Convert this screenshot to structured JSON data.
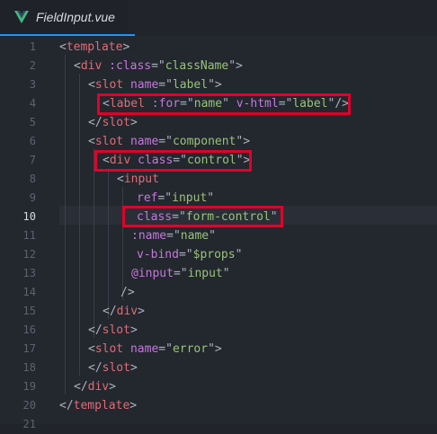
{
  "tab": {
    "title": "FieldInput.vue",
    "icon": "vue-icon"
  },
  "editor": {
    "active_line": 10,
    "line_numbers": [
      "1",
      "2",
      "3",
      "4",
      "5",
      "6",
      "7",
      "8",
      "9",
      "10",
      "11",
      "12",
      "13",
      "14",
      "15",
      "16",
      "17",
      "18",
      "19",
      "20",
      "21"
    ],
    "lines": [
      {
        "n": 1,
        "tokens": [
          [
            "punc",
            "<"
          ],
          [
            "tag",
            "template"
          ],
          [
            "punc",
            ">"
          ]
        ]
      },
      {
        "n": 2,
        "tokens": [
          [
            "punc",
            "<"
          ],
          [
            "tag",
            "div "
          ],
          [
            "attr",
            ":class"
          ],
          [
            "punc",
            "=\""
          ],
          [
            "str",
            "className"
          ],
          [
            "punc",
            "\">"
          ]
        ]
      },
      {
        "n": 3,
        "tokens": [
          [
            "punc",
            "<"
          ],
          [
            "tag",
            "slot "
          ],
          [
            "attr",
            "name"
          ],
          [
            "punc",
            "=\""
          ],
          [
            "str",
            "label"
          ],
          [
            "punc",
            "\">"
          ]
        ]
      },
      {
        "n": 4,
        "tokens": [
          [
            "punc",
            "<"
          ],
          [
            "tag",
            "label "
          ],
          [
            "attr",
            ":for"
          ],
          [
            "punc",
            "=\""
          ],
          [
            "str",
            "name"
          ],
          [
            "punc",
            "\" "
          ],
          [
            "attr",
            "v-html"
          ],
          [
            "punc",
            "=\""
          ],
          [
            "str",
            "label"
          ],
          [
            "punc",
            "\"/>"
          ]
        ]
      },
      {
        "n": 5,
        "tokens": [
          [
            "punc",
            "</"
          ],
          [
            "tag",
            "slot"
          ],
          [
            "punc",
            ">"
          ]
        ]
      },
      {
        "n": 6,
        "tokens": [
          [
            "punc",
            "<"
          ],
          [
            "tag",
            "slot "
          ],
          [
            "attr",
            "name"
          ],
          [
            "punc",
            "=\""
          ],
          [
            "str",
            "component"
          ],
          [
            "punc",
            "\">"
          ]
        ]
      },
      {
        "n": 7,
        "tokens": [
          [
            "punc",
            "<"
          ],
          [
            "tag",
            "div "
          ],
          [
            "attr",
            "class"
          ],
          [
            "punc",
            "=\""
          ],
          [
            "str",
            "control"
          ],
          [
            "punc",
            "\">"
          ]
        ]
      },
      {
        "n": 8,
        "tokens": [
          [
            "punc",
            "<"
          ],
          [
            "tag",
            "input"
          ]
        ]
      },
      {
        "n": 9,
        "tokens": [
          [
            "attr",
            "ref"
          ],
          [
            "punc",
            "=\""
          ],
          [
            "str",
            "input"
          ],
          [
            "punc",
            "\""
          ]
        ]
      },
      {
        "n": 10,
        "tokens": [
          [
            "attr",
            "class"
          ],
          [
            "punc",
            "=\""
          ],
          [
            "str",
            "form-control"
          ],
          [
            "punc",
            "\""
          ]
        ]
      },
      {
        "n": 11,
        "tokens": [
          [
            "attr",
            ":name"
          ],
          [
            "punc",
            "=\""
          ],
          [
            "str",
            "name"
          ],
          [
            "punc",
            "\""
          ]
        ]
      },
      {
        "n": 12,
        "tokens": [
          [
            "attr",
            "v-bind"
          ],
          [
            "punc",
            "=\""
          ],
          [
            "str",
            "$props"
          ],
          [
            "punc",
            "\""
          ]
        ]
      },
      {
        "n": 13,
        "tokens": [
          [
            "attr",
            "@input"
          ],
          [
            "punc",
            "=\""
          ],
          [
            "str",
            "input"
          ],
          [
            "punc",
            "\""
          ]
        ]
      },
      {
        "n": 14,
        "tokens": [
          [
            "punc",
            "/>"
          ]
        ]
      },
      {
        "n": 15,
        "tokens": [
          [
            "punc",
            "</"
          ],
          [
            "tag",
            "div"
          ],
          [
            "punc",
            ">"
          ]
        ]
      },
      {
        "n": 16,
        "tokens": [
          [
            "punc",
            "</"
          ],
          [
            "tag",
            "slot"
          ],
          [
            "punc",
            ">"
          ]
        ]
      },
      {
        "n": 17,
        "tokens": [
          [
            "punc",
            "<"
          ],
          [
            "tag",
            "slot "
          ],
          [
            "attr",
            "name"
          ],
          [
            "punc",
            "=\""
          ],
          [
            "str",
            "error"
          ],
          [
            "punc",
            "\">"
          ]
        ]
      },
      {
        "n": 18,
        "tokens": [
          [
            "punc",
            "</"
          ],
          [
            "tag",
            "slot"
          ],
          [
            "punc",
            ">"
          ]
        ]
      },
      {
        "n": 19,
        "tokens": [
          [
            "punc",
            "</"
          ],
          [
            "tag",
            "div"
          ],
          [
            "punc",
            ">"
          ]
        ]
      },
      {
        "n": 20,
        "tokens": [
          [
            "punc",
            "</"
          ],
          [
            "tag",
            "template"
          ],
          [
            "punc",
            ">"
          ]
        ]
      },
      {
        "n": 21,
        "tokens": []
      }
    ]
  },
  "colors": {
    "highlight_box": "#e1002a",
    "tab_underline": "#1c95ff",
    "background": "#23272e"
  }
}
